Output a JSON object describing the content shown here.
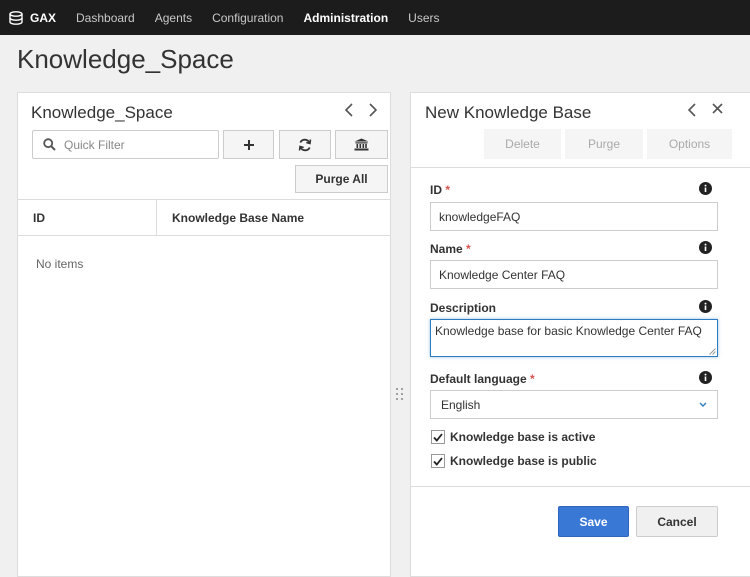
{
  "nav": {
    "brand": "GAX",
    "items": [
      {
        "label": "Dashboard",
        "active": false
      },
      {
        "label": "Agents",
        "active": false
      },
      {
        "label": "Configuration",
        "active": false
      },
      {
        "label": "Administration",
        "active": true
      },
      {
        "label": "Users",
        "active": false
      }
    ]
  },
  "page": {
    "title": "Knowledge_Space"
  },
  "left_panel": {
    "title": "Knowledge_Space",
    "filter_placeholder": "Quick Filter",
    "purge_all_label": "Purge All",
    "columns": [
      "ID",
      "Knowledge Base Name"
    ],
    "empty_text": "No items"
  },
  "right_panel": {
    "title": "New Knowledge Base",
    "actions": {
      "delete": "Delete",
      "purge": "Purge",
      "options": "Options"
    },
    "fields": {
      "id": {
        "label": "ID",
        "required": "*",
        "value": "knowledgeFAQ"
      },
      "name": {
        "label": "Name",
        "required": "*",
        "value": "Knowledge Center FAQ"
      },
      "description": {
        "label": "Description",
        "value": "Knowledge base for basic Knowledge Center FAQ"
      },
      "language": {
        "label": "Default language",
        "required": "*",
        "value": "English"
      }
    },
    "checks": {
      "active": {
        "label": "Knowledge base is active",
        "checked": true
      },
      "public": {
        "label": "Knowledge base is public",
        "checked": true
      }
    },
    "save_label": "Save",
    "cancel_label": "Cancel"
  },
  "colors": {
    "accent": "#3a78d6",
    "nav_bg": "#1c1c1c",
    "required": "#d9534f"
  }
}
